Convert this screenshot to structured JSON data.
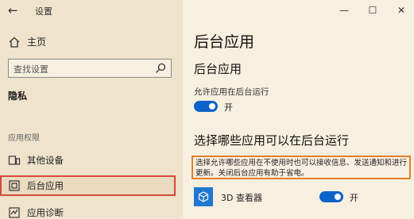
{
  "window": {
    "app_title": "设置",
    "back_icon": "back-arrow-icon",
    "caption": {
      "minimize": "—",
      "maximize": "☐",
      "close": "✕"
    }
  },
  "sidebar": {
    "home_label": "主页",
    "search_placeholder": "查找设置",
    "privacy_heading": "隐私",
    "section_label": "应用权限",
    "items": [
      {
        "label": "其他设备",
        "icon": "devices-icon"
      },
      {
        "label": "后台应用",
        "icon": "background-apps-icon",
        "selected": true
      },
      {
        "label": "应用诊断",
        "icon": "diagnostics-icon"
      }
    ]
  },
  "main": {
    "page_title": "后台应用",
    "sub_title": "后台应用",
    "allow_label": "允许应用在后台运行",
    "allow_toggle_state": "开",
    "section_title": "选择哪些应用可以在后台运行",
    "description": "选择允许哪些应用在不使用时也可以接收信息、发送通知和进行更新。关闭后台应用有助于省电。",
    "apps": [
      {
        "name": "3D 查看器",
        "toggle_state": "开",
        "icon": "3d-cube-icon"
      }
    ]
  },
  "colors": {
    "accent": "#0b63c8",
    "highlight_red": "#d9473c",
    "highlight_orange": "#e0802a"
  }
}
